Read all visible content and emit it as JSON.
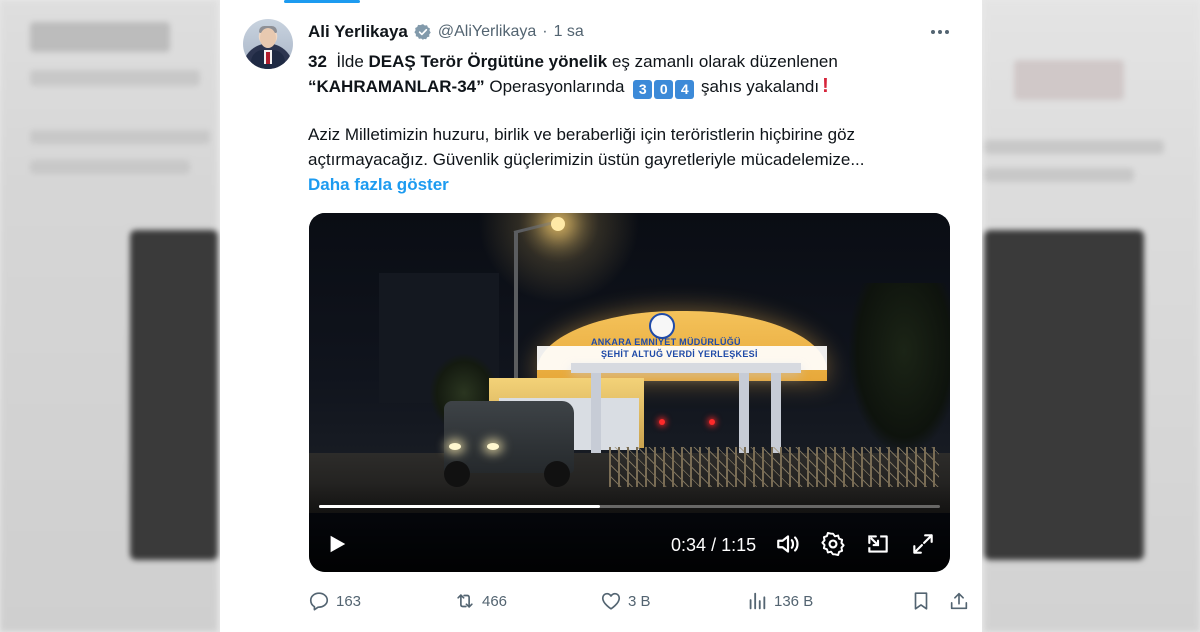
{
  "tweet": {
    "author_name": "Ali Yerlikaya",
    "handle": "@AliYerlikaya",
    "separator": "·",
    "time": "1 sa",
    "line1": {
      "num": "32",
      "pre": "İlde",
      "bold": "DEAŞ Terör Örgütüne yönelik",
      "rest": "eş zamanlı olarak düzenlenen"
    },
    "line2": {
      "bold": "“KAHRAMANLAR-34”",
      "mid": "Operasyonlarında",
      "digits": [
        "3",
        "0",
        "4"
      ],
      "rest": "şahıs yakalandı",
      "exclamation": "!"
    },
    "para2_line1": "Aziz Milletimizin huzuru, birlik ve beraberliği için teröristlerin hiçbirine göz",
    "para2_line2": "açtırmayacağız. Güvenlik güçlerimizin üstün gayretleriyle mücadelemize...",
    "show_more": "Daha fazla göster"
  },
  "video": {
    "sign_line1": "ANKARA EMNİYET MÜDÜRLÜĞÜ",
    "sign_line2": "ŞEHİT ALTUĞ VERDİ YERLEŞKESİ",
    "current_time": "0:34",
    "time_separator": "/",
    "duration": "1:15",
    "progress_fraction": 0.453
  },
  "actions": {
    "replies": "163",
    "reposts": "466",
    "likes": "3 B",
    "views": "136 B"
  },
  "colors": {
    "accent": "#1d9bf0",
    "text": "#0f1419",
    "muted": "#536471",
    "digit_box": "#3c8ad8",
    "exclamation": "#d6243a"
  },
  "icons": [
    "verified-badge-icon",
    "more-dots-icon",
    "play-icon",
    "volume-icon",
    "settings-gear-icon",
    "pip-icon",
    "fullscreen-icon",
    "reply-icon",
    "repost-icon",
    "like-heart-icon",
    "views-chart-icon",
    "bookmark-icon",
    "share-icon"
  ]
}
